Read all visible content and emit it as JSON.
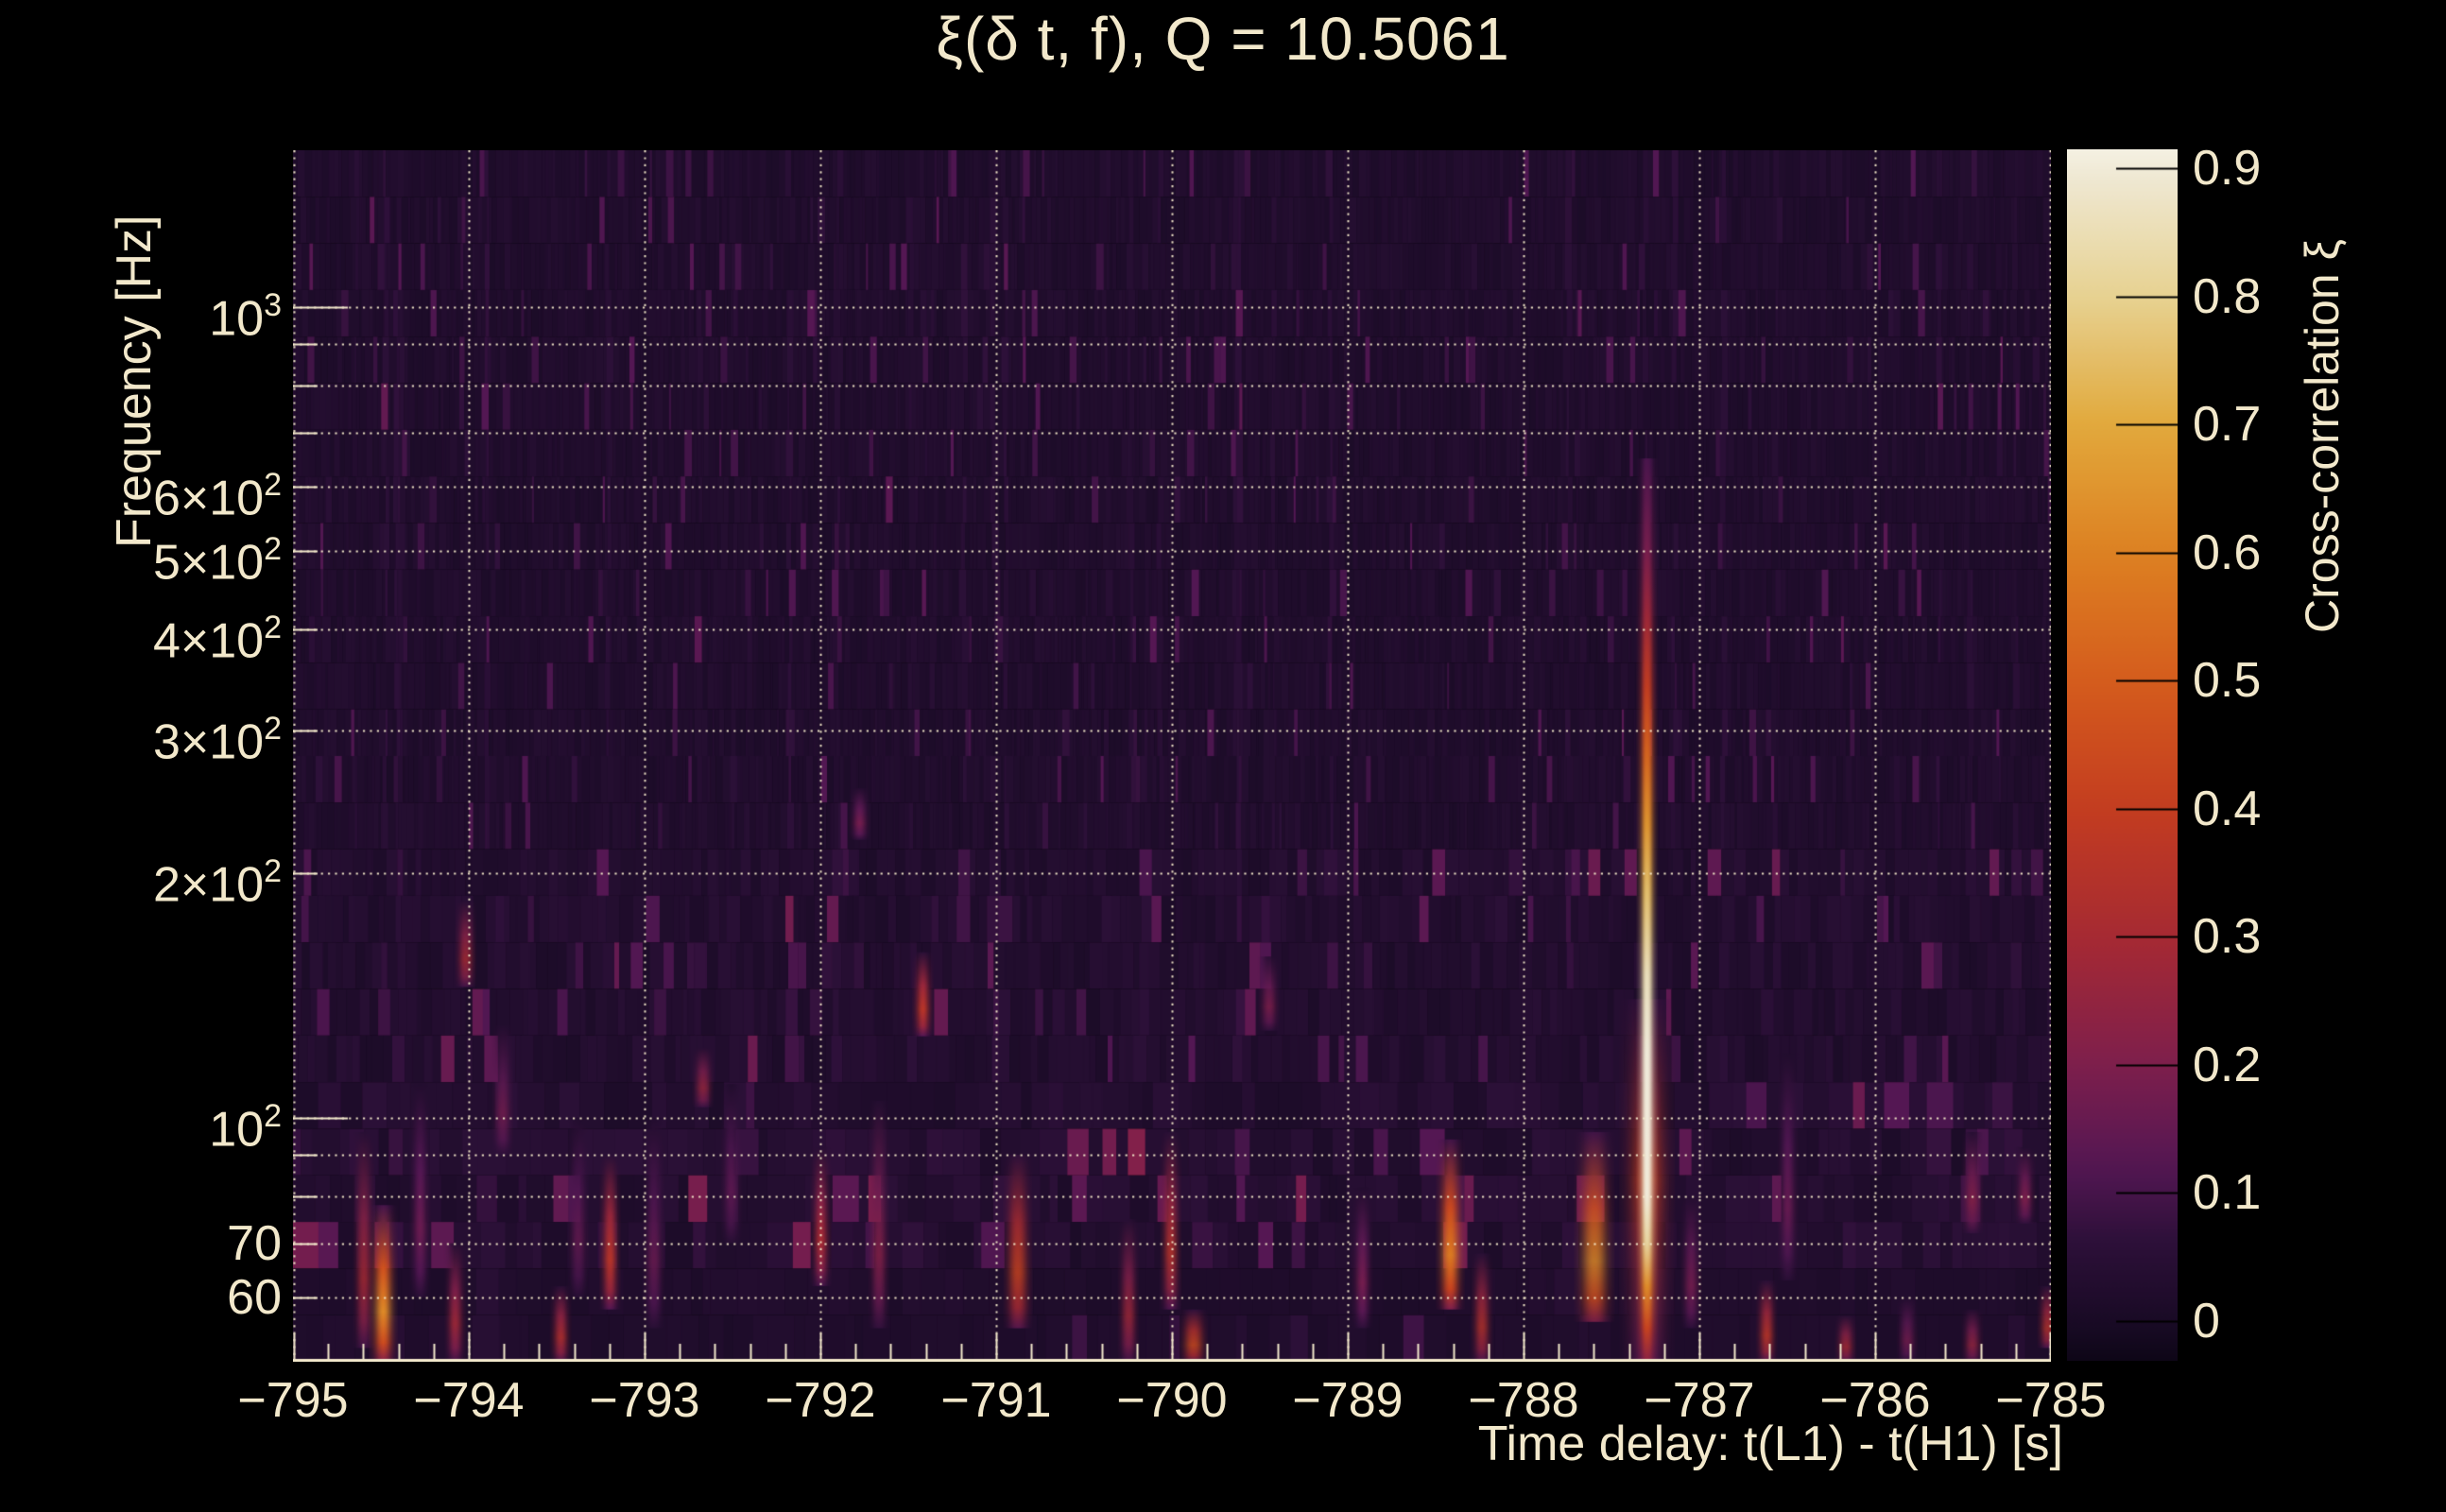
{
  "title": "ξ(δ t, f), Q = 10.5061",
  "colors": {
    "background": "#000000",
    "text": "#f2e8cb",
    "grid": "rgba(243,233,201,0.95)",
    "axis": "#f2e8cb",
    "colorbar_tick": "#000000"
  },
  "axes": {
    "x": {
      "title": "Time delay: t(L1) - t(H1) [s]",
      "min": -795,
      "max": -785,
      "minor_step": 0.2,
      "ticks": [
        {
          "label": "−795",
          "value": -795
        },
        {
          "label": "−794",
          "value": -794
        },
        {
          "label": "−793",
          "value": -793
        },
        {
          "label": "−792",
          "value": -792
        },
        {
          "label": "−791",
          "value": -791
        },
        {
          "label": "−790",
          "value": -790
        },
        {
          "label": "−789",
          "value": -789
        },
        {
          "label": "−788",
          "value": -788
        },
        {
          "label": "−787",
          "value": -787
        },
        {
          "label": "−786",
          "value": -786
        },
        {
          "label": "−785",
          "value": -785
        }
      ]
    },
    "y": {
      "title": "Frequency [Hz]",
      "scale": "log",
      "min": 50,
      "max": 1560,
      "ticks": [
        {
          "base": "10",
          "sup": "3",
          "value": 1000
        },
        {
          "base": "6×10",
          "sup": "2",
          "value": 600
        },
        {
          "base": "5×10",
          "sup": "2",
          "value": 500
        },
        {
          "base": "4×10",
          "sup": "2",
          "value": 400
        },
        {
          "base": "3×10",
          "sup": "2",
          "value": 300
        },
        {
          "base": "2×10",
          "sup": "2",
          "value": 200
        },
        {
          "base": "10",
          "sup": "2",
          "value": 100
        },
        {
          "base": "70",
          "sup": "",
          "value": 70
        },
        {
          "base": "60",
          "sup": "",
          "value": 60
        }
      ],
      "long_tick_values": [
        1000,
        100
      ],
      "short_tick_values": [
        900,
        800,
        700,
        600,
        500,
        400,
        300,
        200,
        90,
        80,
        70,
        60
      ],
      "gridline_values": [
        1000,
        900,
        800,
        700,
        600,
        500,
        400,
        300,
        200,
        100,
        90,
        80,
        70,
        60
      ]
    },
    "z": {
      "title": "Cross-correlation ξ",
      "min": -0.031,
      "max": 0.915,
      "ticks": [
        {
          "label": "0.9",
          "value": 0.9
        },
        {
          "label": "0.8",
          "value": 0.8
        },
        {
          "label": "0.7",
          "value": 0.7
        },
        {
          "label": "0.6",
          "value": 0.6
        },
        {
          "label": "0.5",
          "value": 0.5
        },
        {
          "label": "0.4",
          "value": 0.4
        },
        {
          "label": "0.3",
          "value": 0.3
        },
        {
          "label": "0.2",
          "value": 0.2
        },
        {
          "label": "0.1",
          "value": 0.1
        },
        {
          "label": "0",
          "value": 0
        }
      ]
    }
  },
  "chart_data": {
    "type": "heatmap",
    "title": "ξ(δ t, f), Q = 10.5061",
    "x_range": [
      -795,
      -785
    ],
    "y_range": [
      50,
      1560
    ],
    "z_range": [
      -0.031,
      0.915
    ],
    "grid": true,
    "peak": {
      "time_delay": -787.3,
      "xi": 0.91,
      "frequency_span_hz": [
        50,
        650
      ]
    },
    "colormap": [
      [
        -0.04,
        "#0a0413"
      ],
      [
        0.0,
        "#1a0b26"
      ],
      [
        0.06,
        "#2c1038"
      ],
      [
        0.12,
        "#531753"
      ],
      [
        0.2,
        "#7e1f4c"
      ],
      [
        0.3,
        "#a62a33"
      ],
      [
        0.4,
        "#c43d20"
      ],
      [
        0.5,
        "#d55c1d"
      ],
      [
        0.6,
        "#dd8122"
      ],
      [
        0.7,
        "#e2a93c"
      ],
      [
        0.8,
        "#e7d292"
      ],
      [
        0.9,
        "#f0ead8"
      ],
      [
        0.915,
        "#f5f1e3"
      ]
    ],
    "noise": {
      "seed": 20250101,
      "rows": 26,
      "base": 0.008,
      "amp": 0.038,
      "sparkle_p": 0.07,
      "sparkle_amp": 0.1,
      "col_boost_p": 0.1,
      "col_boost_amp": 0.05
    },
    "main_event": {
      "t": -787.3,
      "sigma": 4.5,
      "profile": [
        [
          650,
          0.1
        ],
        [
          500,
          0.18
        ],
        [
          420,
          0.26
        ],
        [
          340,
          0.38
        ],
        [
          280,
          0.5
        ],
        [
          230,
          0.62
        ],
        [
          190,
          0.72
        ],
        [
          150,
          0.82
        ],
        [
          120,
          0.88
        ],
        [
          95,
          0.9
        ],
        [
          80,
          0.87
        ],
        [
          70,
          0.78
        ],
        [
          62,
          0.6
        ],
        [
          55,
          0.4
        ],
        [
          50,
          0.22
        ]
      ],
      "halo": {
        "f": [
          50,
          140
        ],
        "v": 0.4,
        "sigma": 11
      }
    },
    "features": [
      {
        "t": -794.6,
        "f": [
          52,
          96
        ],
        "v": 0.3
      },
      {
        "t": -794.49,
        "f": [
          50,
          78
        ],
        "v": 0.62,
        "w": 6
      },
      {
        "t": -794.28,
        "f": [
          60,
          110
        ],
        "v": 0.16
      },
      {
        "t": -794.08,
        "f": [
          50,
          70
        ],
        "v": 0.28
      },
      {
        "t": -794.02,
        "f": [
          145,
          185
        ],
        "v": 0.3
      },
      {
        "t": -793.81,
        "f": [
          90,
          130
        ],
        "v": 0.18
      },
      {
        "t": -793.48,
        "f": [
          50,
          62
        ],
        "v": 0.32
      },
      {
        "t": -793.38,
        "f": [
          60,
          100
        ],
        "v": 0.15
      },
      {
        "t": -793.2,
        "f": [
          58,
          90
        ],
        "v": 0.36
      },
      {
        "t": -792.95,
        "f": [
          55,
          100
        ],
        "v": 0.16
      },
      {
        "t": -792.67,
        "f": [
          103,
          122
        ],
        "v": 0.26
      },
      {
        "t": -792.51,
        "f": [
          70,
          110
        ],
        "v": 0.14
      },
      {
        "t": -792.0,
        "f": [
          62,
          92
        ],
        "v": 0.3
      },
      {
        "t": -791.78,
        "f": [
          220,
          255
        ],
        "v": 0.18
      },
      {
        "t": -791.67,
        "f": [
          55,
          105
        ],
        "v": 0.22
      },
      {
        "t": -791.42,
        "f": [
          126,
          160
        ],
        "v": 0.36
      },
      {
        "t": -790.88,
        "f": [
          55,
          90
        ],
        "v": 0.42,
        "w": 6
      },
      {
        "t": -790.25,
        "f": [
          50,
          75
        ],
        "v": 0.28
      },
      {
        "t": -790.01,
        "f": [
          58,
          96
        ],
        "v": 0.34
      },
      {
        "t": -789.88,
        "f": [
          50,
          58
        ],
        "v": 0.44,
        "w": 6
      },
      {
        "t": -789.45,
        "f": [
          128,
          158
        ],
        "v": 0.2
      },
      {
        "t": -788.92,
        "f": [
          55,
          82
        ],
        "v": 0.18
      },
      {
        "t": -788.42,
        "f": [
          58,
          94
        ],
        "v": 0.58,
        "w": 6
      },
      {
        "t": -788.24,
        "f": [
          50,
          68
        ],
        "v": 0.34
      },
      {
        "t": -787.6,
        "f": [
          56,
          96
        ],
        "v": 0.62,
        "w": 8
      },
      {
        "t": -787.05,
        "f": [
          55,
          80
        ],
        "v": 0.18
      },
      {
        "t": -786.62,
        "f": [
          50,
          63
        ],
        "v": 0.36
      },
      {
        "t": -786.5,
        "f": [
          63,
          120
        ],
        "v": 0.15
      },
      {
        "t": -786.17,
        "f": [
          50,
          57
        ],
        "v": 0.3
      },
      {
        "t": -785.82,
        "f": [
          50,
          60
        ],
        "v": 0.18
      },
      {
        "t": -785.45,
        "f": [
          72,
          96
        ],
        "v": 0.22
      },
      {
        "t": -785.45,
        "f": [
          50,
          58
        ],
        "v": 0.25
      },
      {
        "t": -785.15,
        "f": [
          74,
          92
        ],
        "v": 0.2
      },
      {
        "t": -785.02,
        "f": [
          52,
          62
        ],
        "v": 0.34
      }
    ]
  }
}
